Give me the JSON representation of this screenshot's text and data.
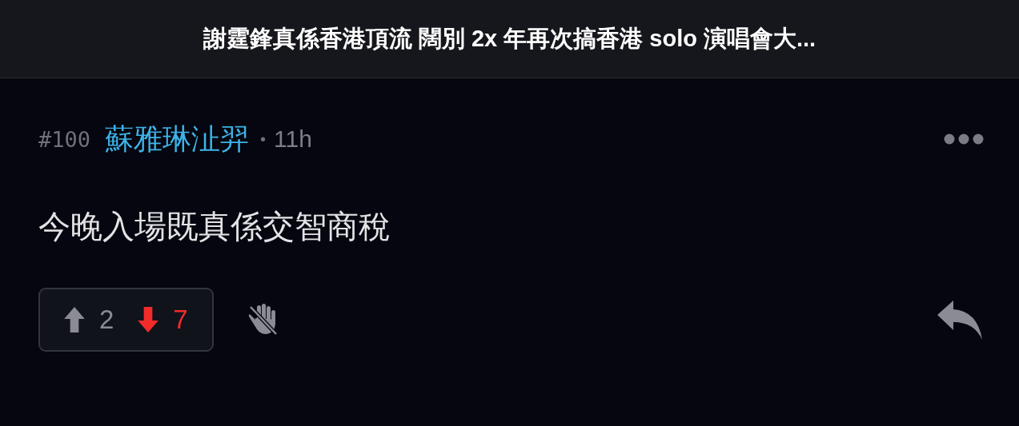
{
  "header": {
    "title": "謝霆鋒真係香港頂流 闊別 2x 年再次搞香港 solo 演唱會大..."
  },
  "post": {
    "number": "#100",
    "author": "蘇雅琳沚羿",
    "separator": "•",
    "time": "11h",
    "content": "今晚入場既真係交智商稅",
    "votes": [
      {
        "kind": "up",
        "count": "2"
      },
      {
        "kind": "down",
        "count": "7"
      }
    ]
  }
}
